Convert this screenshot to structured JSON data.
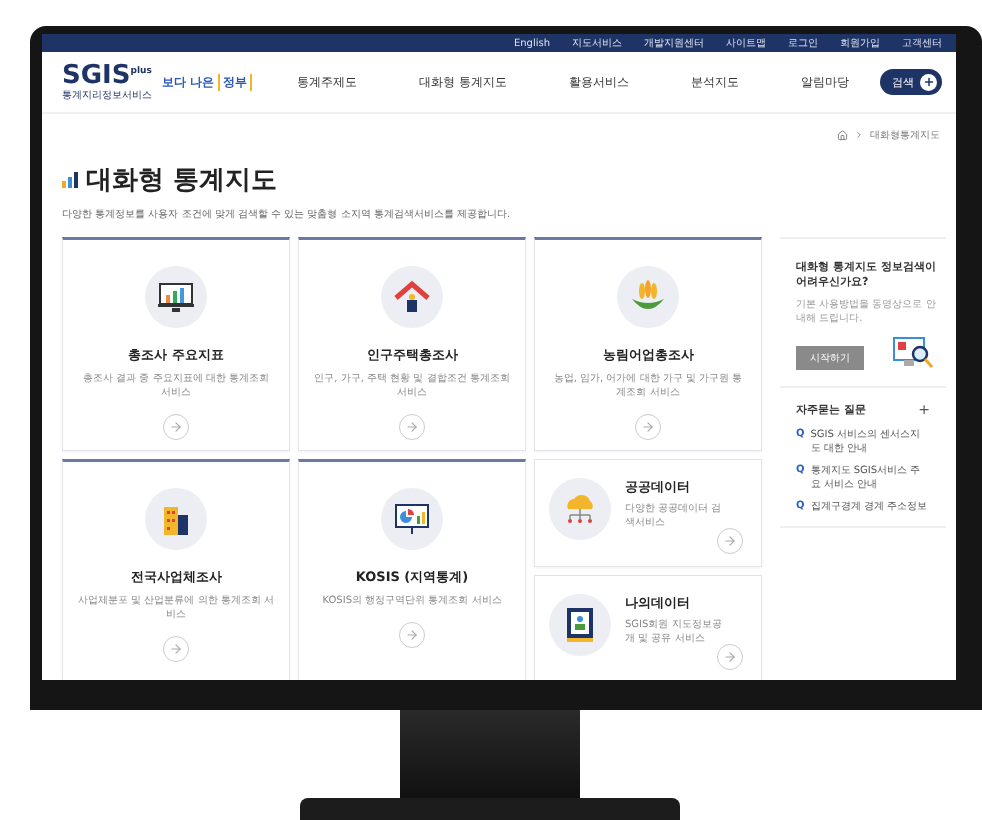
{
  "top_links": [
    "English",
    "지도서비스",
    "개발지원센터",
    "사이트맵",
    "로그인",
    "회원가입",
    "고객센터"
  ],
  "logo": {
    "name": "SGIS",
    "superscript": "plus",
    "subtitle": "통계지리정보서비스",
    "badge": "보다 나은",
    "badge_highlight": "정부"
  },
  "nav": [
    "통계주제도",
    "대화형 통계지도",
    "활용서비스",
    "분석지도",
    "알림마당"
  ],
  "search_button": "검색",
  "breadcrumb": "대화형통계지도",
  "page_title": "대화형 통계지도",
  "description": "다양한 통계정보를 사용자 조건에 맞게 검색할 수 있는 맞춤형 소지역 통계검색서비스를 제공합니다.",
  "cards": [
    {
      "kind": "large",
      "title": "총조사 주요지표",
      "text": "총조사 결과 중 주요지표에 대한 통계조회 서비스"
    },
    {
      "kind": "large",
      "title": "인구주택총조사",
      "text": "인구, 가구, 주택 현황 및 결합조건 통계조회 서비스"
    },
    {
      "kind": "large",
      "title": "농림어업총조사",
      "text": "농업, 임가, 어가에 대한 가구 및 가구원 통계조회 서비스"
    },
    {
      "kind": "large",
      "title": "전국사업체조사",
      "text": "사업체분포 및 산업분류에 의한 통계조회 서비스"
    },
    {
      "kind": "large",
      "title": "KOSIS (지역통계)",
      "text": "KOSIS의 행정구역단위 통계조회 서비스"
    },
    {
      "kind": "compact",
      "title": "공공데이터",
      "text": "다양한 공공데이터 검색서비스"
    },
    {
      "kind": "compact",
      "title": "나의데이터",
      "text": "SGIS회원 지도정보공개 및 공유 서비스"
    }
  ],
  "help": {
    "title": "대화형 통계지도 정보검색이 어려우신가요?",
    "text": "기본 사용방법을 동영상으로 안내해 드립니다.",
    "button": "시작하기"
  },
  "faq": {
    "title": "자주묻는 질문",
    "expand": "+",
    "items": [
      {
        "mark": "Q",
        "text": "SGIS 서비스의 센서스지도 대한 안내"
      },
      {
        "mark": "Q",
        "text": "통계지도 SGIS서비스 주요 서비스 안내"
      },
      {
        "mark": "Q",
        "text": "집계구경계 경계 주소정보"
      }
    ]
  }
}
